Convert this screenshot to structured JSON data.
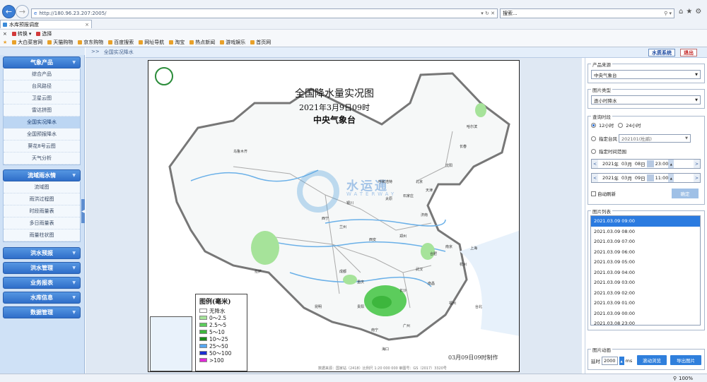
{
  "browser": {
    "url": "http://180.96.23.207:2005/",
    "search_placeholder": "搜索...",
    "tab_title": "水库预报调度",
    "cmd_items": [
      "转换",
      "选择"
    ],
    "favorites": [
      "大白菜官网",
      "天猫购物",
      "京东购物",
      "百度搜索",
      "网址导航",
      "淘宝",
      "热点新闻",
      "游戏娱乐",
      "首页网"
    ],
    "zoom": "100%"
  },
  "sidebar": {
    "sections": [
      {
        "label": "气象产品",
        "items": [
          "综合产品",
          "台风路径",
          "卫星云图",
          "雷达拼图",
          "全国实况降水",
          "全国预报降水",
          "葵花8号云图",
          "天气分析"
        ],
        "selected": "全国实况降水"
      },
      {
        "label": "流域雨水情",
        "items": [
          "流域图",
          "雨洪过程图",
          "时段雨量表",
          "多日雨量表",
          "雨量柱状图"
        ]
      },
      {
        "label": "洪水预报"
      },
      {
        "label": "洪水管理"
      },
      {
        "label": "业务报表"
      },
      {
        "label": "水库信息"
      },
      {
        "label": "数据管理"
      }
    ]
  },
  "topbar": {
    "breadcrumb_sep": ">>",
    "breadcrumb": "全国实况降水",
    "sys_button": "水质系统",
    "exit_button": "退出"
  },
  "map": {
    "title": "全国降水量实况图",
    "date": "2021年3月9日09时",
    "agency": "中央气象台",
    "made": "03月09日09时制作",
    "source": "数据来源：国家站（2418）比例尺 1:20 000 000 审图号：GS（2017）3320号",
    "watermark": "水运通",
    "watermark_en": "WATERWAY",
    "legend_title": "图例(毫米)",
    "legend": [
      {
        "label": "无降水",
        "color": "#ffffff"
      },
      {
        "label": "0～2.5",
        "color": "#a6e39a"
      },
      {
        "label": "2.5～5",
        "color": "#5ccc5c"
      },
      {
        "label": "5～10",
        "color": "#3db63d"
      },
      {
        "label": "10～25",
        "color": "#1a8a1a"
      },
      {
        "label": "25～50",
        "color": "#57a7f1"
      },
      {
        "label": "50～100",
        "color": "#1a2fd0"
      },
      {
        "label": ">100",
        "color": "#e029d6"
      }
    ],
    "cities": [
      "乌鲁木齐",
      "哈尔滨",
      "长春",
      "沈阳",
      "北京",
      "天津",
      "石家庄",
      "太原",
      "呼和浩特",
      "银川",
      "西宁",
      "兰州",
      "西安",
      "郑州",
      "济南",
      "南京",
      "合肥",
      "武汉",
      "成都",
      "重庆",
      "贵阳",
      "长沙",
      "南昌",
      "杭州",
      "福州",
      "昆明",
      "南宁",
      "广州",
      "海口",
      "拉萨",
      "台北",
      "上海"
    ]
  },
  "right": {
    "product_source_label": "产品来源",
    "product_source": "中央气象台",
    "image_type_label": "图片类型",
    "image_type": "逐小时降水",
    "query_time_label": "查询时段",
    "radio_12h": "12小时",
    "radio_24h": "24小时",
    "typhoon_label": "指定台风",
    "typhoon_value": "202101(杜鹃)",
    "range_label": "指定时间范围",
    "start": {
      "year": "2021",
      "year_unit": "年",
      "month": "03",
      "month_unit": "月",
      "day": "08",
      "day_unit": "日",
      "time": "23:00"
    },
    "end": {
      "year": "2021",
      "year_unit": "年",
      "month": "03",
      "month_unit": "月",
      "day": "09",
      "day_unit": "日",
      "time": "11:00"
    },
    "auto_refresh": "自动刷新",
    "ok": "确定",
    "list_label": "图片列表",
    "images": [
      "2021.03.09 09:00",
      "2021.03.09 08:00",
      "2021.03.09 07:00",
      "2021.03.09 06:00",
      "2021.03.09 05:00",
      "2021.03.09 04:00",
      "2021.03.09 03:00",
      "2021.03.09 02:00",
      "2021.03.09 01:00",
      "2021.03.09 00:00",
      "2021.03.08 23:00"
    ],
    "selected_image": "2021.03.09 09:00",
    "anim_label": "图片动画",
    "delay_label": "延时",
    "delay": "2000",
    "delay_unit": "ms",
    "play_button": "滚动浏览",
    "export_button": "导出图片"
  }
}
